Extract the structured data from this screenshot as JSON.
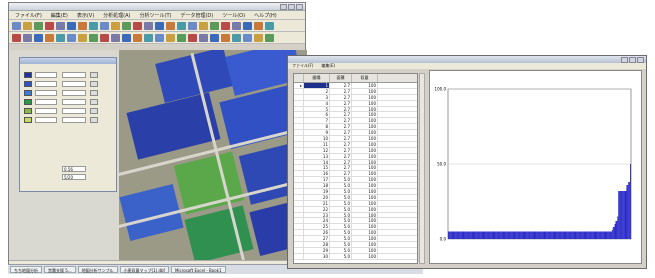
{
  "main_window": {
    "menu": [
      "ファイル(F)",
      "編集(E)",
      "表示(V)",
      "分析処理(A)",
      "分析ツール(T)",
      "データ管理(D)",
      "ツール(O)",
      "ヘルプ(H)"
    ]
  },
  "legend_panel": {
    "colors": [
      "#2230a8",
      "#2f52c8",
      "#3b7ad8",
      "#2a9a4a",
      "#8ab84a",
      "#c8d860"
    ],
    "field1_value": "0.56",
    "field2_value": "5/20"
  },
  "taskbar": {
    "items": [
      "ちち地図分析",
      "営農支援 5...",
      "地図分析サンプル",
      "小麦収量マップ(1).dbf",
      "Microsoft Excel - Book1"
    ]
  },
  "data_window": {
    "menu": [
      "ファイル(F)",
      "編集(E)"
    ],
    "columns": [
      "",
      "圃場",
      "面積",
      "収量"
    ],
    "marker": "▸",
    "rows": [
      [
        "",
        "1",
        "2.7",
        "100"
      ],
      [
        "",
        "2",
        "2.7",
        "100"
      ],
      [
        "",
        "3",
        "2.7",
        "100"
      ],
      [
        "",
        "4",
        "2.7",
        "100"
      ],
      [
        "",
        "5",
        "2.7",
        "100"
      ],
      [
        "",
        "6",
        "2.7",
        "100"
      ],
      [
        "",
        "7",
        "2.7",
        "100"
      ],
      [
        "",
        "8",
        "2.7",
        "100"
      ],
      [
        "",
        "9",
        "2.7",
        "100"
      ],
      [
        "",
        "10",
        "2.7",
        "100"
      ],
      [
        "",
        "11",
        "2.7",
        "100"
      ],
      [
        "",
        "12",
        "2.7",
        "100"
      ],
      [
        "",
        "13",
        "2.7",
        "100"
      ],
      [
        "",
        "14",
        "2.7",
        "100"
      ],
      [
        "",
        "15",
        "2.7",
        "100"
      ],
      [
        "",
        "16",
        "2.7",
        "100"
      ],
      [
        "",
        "17",
        "5.0",
        "100"
      ],
      [
        "",
        "18",
        "5.0",
        "100"
      ],
      [
        "",
        "19",
        "5.0",
        "100"
      ],
      [
        "",
        "20",
        "5.0",
        "100"
      ],
      [
        "",
        "21",
        "5.0",
        "100"
      ],
      [
        "",
        "22",
        "5.0",
        "100"
      ],
      [
        "",
        "23",
        "5.0",
        "100"
      ],
      [
        "",
        "24",
        "5.0",
        "100"
      ],
      [
        "",
        "25",
        "5.0",
        "100"
      ],
      [
        "",
        "26",
        "5.0",
        "100"
      ],
      [
        "",
        "27",
        "5.0",
        "100"
      ],
      [
        "",
        "28",
        "5.0",
        "100"
      ],
      [
        "",
        "29",
        "5.0",
        "100"
      ],
      [
        "",
        "30",
        "5.0",
        "100"
      ]
    ]
  },
  "chart_data": {
    "type": "bar",
    "title": "",
    "xlabel": "",
    "ylabel": "",
    "ylim": [
      0,
      100
    ],
    "yticks": [
      0,
      50,
      100
    ],
    "color": "#2626c8",
    "values": [
      5,
      5,
      5,
      5,
      5,
      5,
      5,
      5,
      5,
      5,
      5,
      5,
      5,
      5,
      5,
      5,
      5,
      5,
      5,
      5,
      5,
      5,
      5,
      5,
      5,
      5,
      5,
      5,
      5,
      5,
      5,
      5,
      5,
      5,
      5,
      5,
      5,
      5,
      5,
      5,
      5,
      5,
      5,
      5,
      5,
      5,
      5,
      5,
      5,
      5,
      5,
      5,
      5,
      5,
      5,
      5,
      5,
      5,
      5,
      5,
      5,
      5,
      5,
      5,
      5,
      5,
      5,
      5,
      5,
      5,
      5,
      5,
      5,
      5,
      5,
      5,
      5,
      5,
      5,
      5,
      5,
      5,
      5,
      5,
      5,
      5,
      5,
      5,
      5,
      5,
      5,
      5,
      5,
      5,
      5,
      5,
      5,
      5,
      5,
      5,
      5,
      5,
      5,
      5,
      5,
      5,
      5,
      5,
      5,
      5,
      5,
      5,
      5,
      5,
      5,
      5,
      5,
      5,
      5,
      5,
      5,
      5,
      5,
      5,
      5,
      5,
      5,
      5,
      5,
      5,
      5,
      5,
      5,
      5,
      5,
      5,
      5,
      5,
      5,
      5,
      5,
      5,
      5,
      5,
      5,
      5,
      5,
      5,
      5,
      5,
      5,
      5,
      5,
      5,
      5,
      5,
      5,
      5,
      5,
      5,
      5,
      5,
      5,
      5,
      5,
      5,
      5,
      5,
      5,
      5,
      5,
      5,
      5,
      5,
      5,
      5,
      5,
      5,
      5,
      5,
      6,
      8,
      8,
      10,
      12,
      12,
      15,
      32,
      32,
      32,
      32,
      32,
      32,
      32,
      32,
      32,
      36,
      36,
      38,
      38,
      50
    ]
  }
}
